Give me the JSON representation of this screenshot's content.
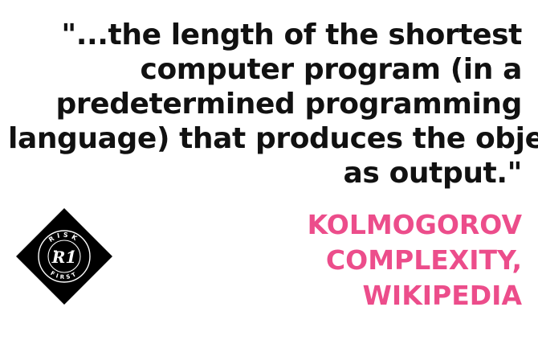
{
  "quote": {
    "lines": [
      "\"...the length of the shortest",
      "computer program (in a",
      "predetermined programming",
      "language) that produces the object",
      "as output.\""
    ]
  },
  "attribution": {
    "lines": [
      "KOLMOGOROV",
      "COMPLEXITY,",
      "WIKIPEDIA"
    ]
  },
  "logo": {
    "icon": "risk-first-diamond-logo",
    "text_top": "RISK",
    "text_bottom": "FIRST",
    "monogram": "R1"
  },
  "colors": {
    "text": "#111111",
    "accent": "#ec4d8b",
    "background": "#ffffff",
    "logo": "#000000"
  }
}
